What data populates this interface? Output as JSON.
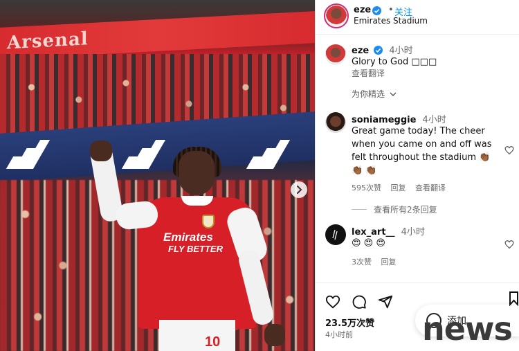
{
  "post": {
    "photo_banner_text": "Arsenal",
    "sponsor_line1": "Emirates",
    "sponsor_line2": "FLY BETTER",
    "shorts_number": "10"
  },
  "header": {
    "username": "eze",
    "follow_label": "关注",
    "separator": "•",
    "location": "Emirates Stadium"
  },
  "caption": {
    "username": "eze",
    "time": "4小时",
    "text": "Glory to God □□□",
    "translate_label": "查看翻译"
  },
  "sort_label": "为你精选",
  "comments": [
    {
      "username": "soniameggie",
      "time": "4小时",
      "text": "Great game today! The cheer when you came on and off was felt throughout the stadium",
      "emoji": "👏🏾 👏🏾 👏🏾",
      "likes": "595次赞",
      "reply_label": "回复",
      "translate_label": "查看翻译",
      "view_replies": "查看所有2条回复"
    },
    {
      "username": "lex_art__",
      "time": "4小时",
      "text": "😍 😍 😍",
      "likes": "3次赞",
      "reply_label": "回复"
    }
  ],
  "footer": {
    "likes": "23.5万次赞",
    "posted_time": "4小时前",
    "comment_pill_text": "添加"
  },
  "watermark": "news",
  "icons": {
    "heart": "heart-icon",
    "comment": "comment-icon",
    "share": "share-icon",
    "bookmark": "bookmark-icon",
    "verified": "verified-icon",
    "next": "chevron-right-icon"
  },
  "colors": {
    "link_blue": "#0095f6",
    "verified_blue": "#1d8cf0",
    "arsenal_red": "#d61f26"
  }
}
